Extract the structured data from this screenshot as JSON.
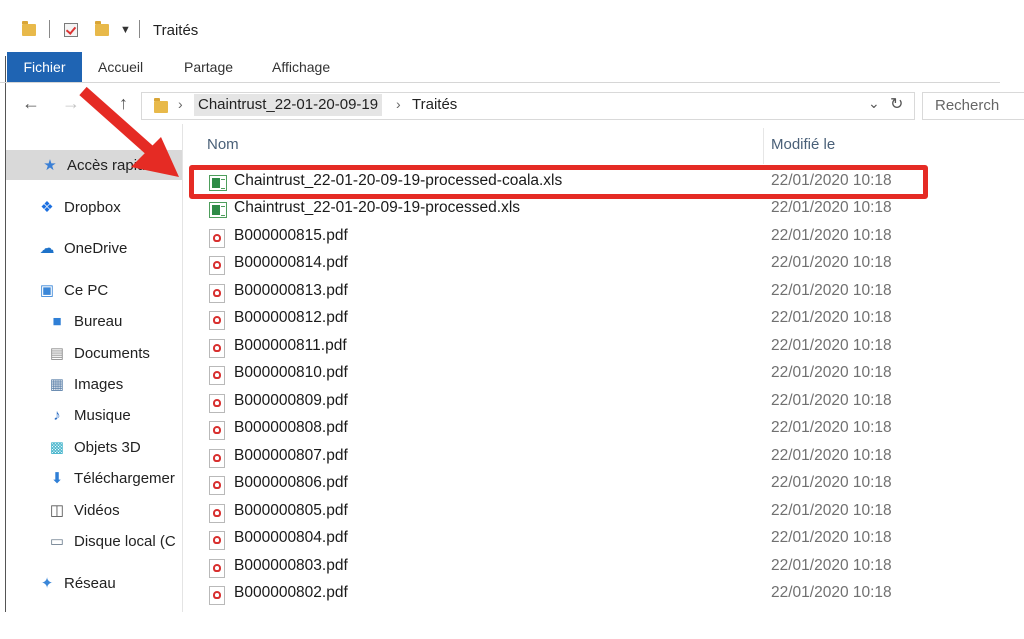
{
  "window": {
    "title": "Traités"
  },
  "ribbon": {
    "tabs": [
      {
        "label": "Fichier"
      },
      {
        "label": "Accueil"
      },
      {
        "label": "Partage"
      },
      {
        "label": "Affichage"
      }
    ]
  },
  "address": {
    "crumbs": [
      {
        "label": "Chaintrust_22-01-20-09-19"
      },
      {
        "label": "Traités"
      }
    ],
    "search_placeholder": "Recherch"
  },
  "sidebar": {
    "items": [
      {
        "label": "Accès rapide",
        "icon": "star-icon",
        "selected": true
      },
      {
        "label": "Dropbox",
        "icon": "dropbox-icon"
      },
      {
        "label": "OneDrive",
        "icon": "cloud-icon"
      },
      {
        "label": "Ce PC",
        "icon": "computer-icon"
      },
      {
        "label": "Bureau",
        "icon": "desktop-icon"
      },
      {
        "label": "Documents",
        "icon": "document-icon"
      },
      {
        "label": "Images",
        "icon": "image-icon"
      },
      {
        "label": "Musique",
        "icon": "music-icon"
      },
      {
        "label": "Objets 3D",
        "icon": "cube-icon"
      },
      {
        "label": "Téléchargemer",
        "icon": "download-icon"
      },
      {
        "label": "Vidéos",
        "icon": "video-icon"
      },
      {
        "label": "Disque local (C",
        "icon": "drive-icon"
      },
      {
        "label": "Réseau",
        "icon": "network-icon"
      }
    ]
  },
  "columns": {
    "name": "Nom",
    "modified": "Modifié le"
  },
  "files": [
    {
      "name": "Chaintrust_22-01-20-09-19-processed-coala.xls",
      "date": "22/01/2020 10:18",
      "type": "xls"
    },
    {
      "name": "Chaintrust_22-01-20-09-19-processed.xls",
      "date": "22/01/2020 10:18",
      "type": "xls"
    },
    {
      "name": "B000000815.pdf",
      "date": "22/01/2020 10:18",
      "type": "pdf"
    },
    {
      "name": "B000000814.pdf",
      "date": "22/01/2020 10:18",
      "type": "pdf"
    },
    {
      "name": "B000000813.pdf",
      "date": "22/01/2020 10:18",
      "type": "pdf"
    },
    {
      "name": "B000000812.pdf",
      "date": "22/01/2020 10:18",
      "type": "pdf"
    },
    {
      "name": "B000000811.pdf",
      "date": "22/01/2020 10:18",
      "type": "pdf"
    },
    {
      "name": "B000000810.pdf",
      "date": "22/01/2020 10:18",
      "type": "pdf"
    },
    {
      "name": "B000000809.pdf",
      "date": "22/01/2020 10:18",
      "type": "pdf"
    },
    {
      "name": "B000000808.pdf",
      "date": "22/01/2020 10:18",
      "type": "pdf"
    },
    {
      "name": "B000000807.pdf",
      "date": "22/01/2020 10:18",
      "type": "pdf"
    },
    {
      "name": "B000000806.pdf",
      "date": "22/01/2020 10:18",
      "type": "pdf"
    },
    {
      "name": "B000000805.pdf",
      "date": "22/01/2020 10:18",
      "type": "pdf"
    },
    {
      "name": "B000000804.pdf",
      "date": "22/01/2020 10:18",
      "type": "pdf"
    },
    {
      "name": "B000000803.pdf",
      "date": "22/01/2020 10:18",
      "type": "pdf"
    },
    {
      "name": "B000000802.pdf",
      "date": "22/01/2020 10:18",
      "type": "pdf"
    }
  ],
  "annotation": {
    "color": "#e52b24"
  },
  "colors": {
    "accent": "#1f64b3"
  }
}
